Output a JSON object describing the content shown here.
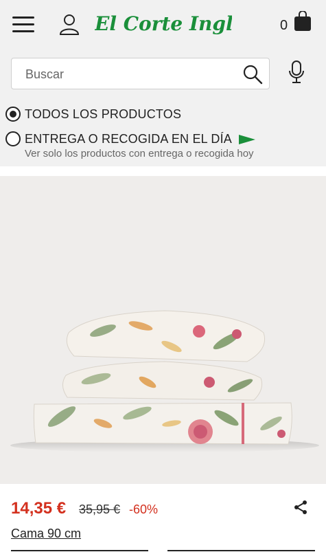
{
  "header": {
    "brand": "El Corte Inglés",
    "cart_count": "0"
  },
  "search": {
    "placeholder": "Buscar"
  },
  "filters": {
    "all_products": "TODOS LOS PRODUCTOS",
    "same_day": "ENTREGA O RECOGIDA EN EL DÍA",
    "same_day_subtitle": "Ver solo los productos con entrega o recogida hoy"
  },
  "product": {
    "price": "14,35 €",
    "old_price": "35,95 €",
    "discount": "-60%",
    "size": "Cama 90 cm"
  },
  "colors": {
    "brand_green": "#1a8f3a",
    "price_red": "#d3301e"
  }
}
